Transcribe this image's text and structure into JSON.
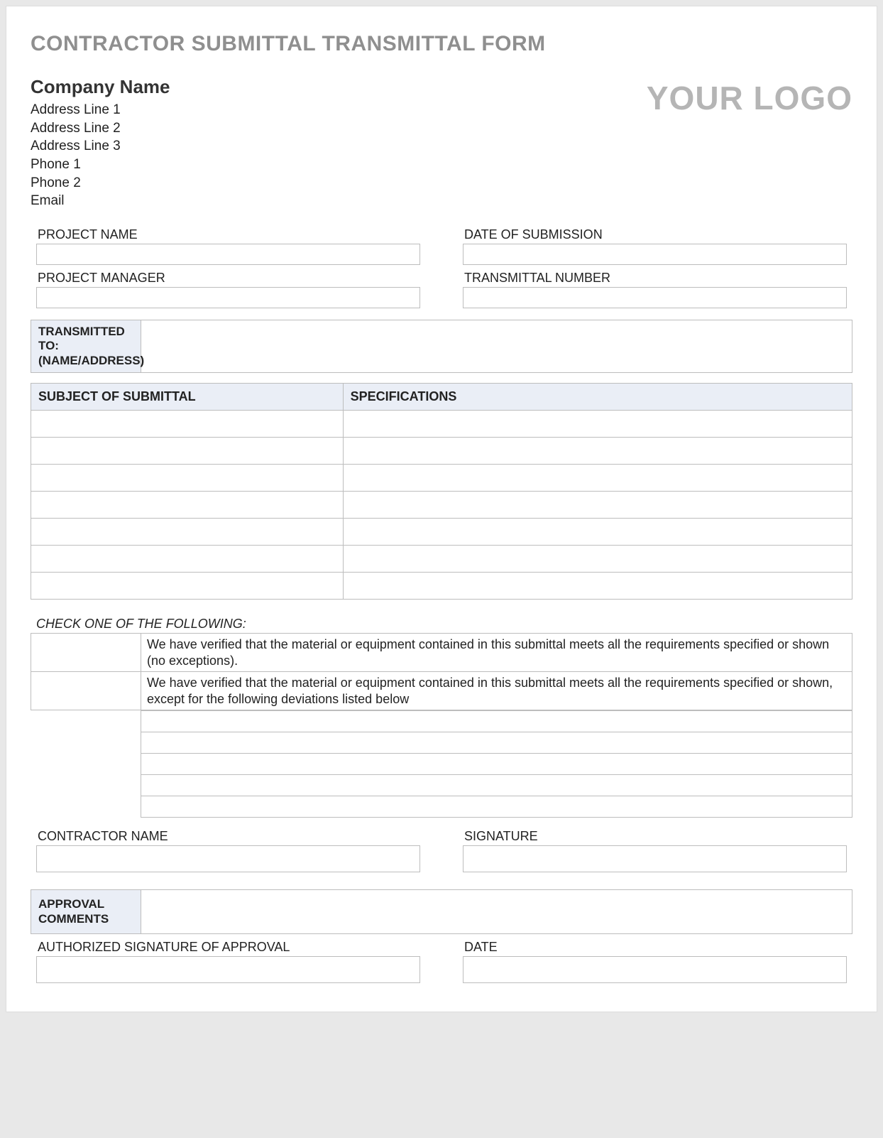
{
  "title": "CONTRACTOR SUBMITTAL TRANSMITTAL FORM",
  "company": {
    "name": "Company Name",
    "addr1": "Address Line 1",
    "addr2": "Address Line 2",
    "addr3": "Address Line 3",
    "phone1": "Phone 1",
    "phone2": "Phone 2",
    "email": "Email"
  },
  "logo_text": "YOUR LOGO",
  "fields": {
    "project_name_label": "PROJECT NAME",
    "date_of_submission_label": "DATE OF SUBMISSION",
    "project_manager_label": "PROJECT MANAGER",
    "transmittal_number_label": "TRANSMITTAL NUMBER",
    "contractor_name_label": "CONTRACTOR NAME",
    "signature_label": "SIGNATURE",
    "authorized_signature_label": "AUTHORIZED SIGNATURE OF APPROVAL",
    "date_label": "DATE"
  },
  "transmitted_to_label": "TRANSMITTED TO: (NAME/ADDRESS)",
  "subject_table": {
    "col1": "SUBJECT OF SUBMITTAL",
    "col2": "SPECIFICATIONS",
    "row_count": 7
  },
  "check": {
    "heading": "CHECK ONE OF THE FOLLOWING:",
    "opt1": "We have verified that the material or equipment contained in this submittal meets all the requirements specified or shown (no exceptions).",
    "opt2": "We have verified that the material or equipment contained in this submittal meets all the requirements specified or shown, except for the following deviations listed below",
    "deviation_rows": 5
  },
  "approval_comments_label": "APPROVAL COMMENTS"
}
